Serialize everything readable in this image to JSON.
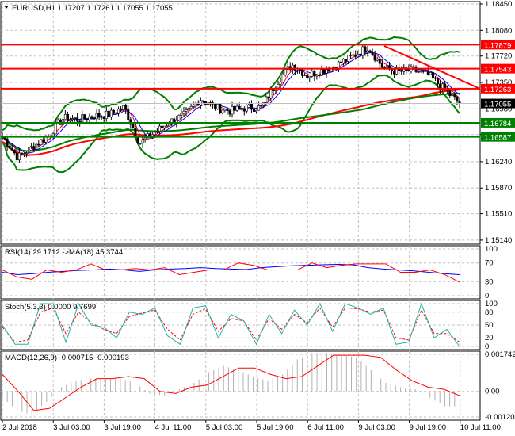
{
  "chart_data": [
    {
      "type": "candlestick",
      "title": "EURUSD,H1",
      "ohlc_header": [
        "1.17207",
        "1.17261",
        "1.17055",
        "1.17055"
      ],
      "y_ticks": [
        "1.18450",
        "1.18080",
        "1.17720",
        "1.17350",
        "1.16980",
        "1.16620",
        "1.16240",
        "1.15870",
        "1.15510",
        "1.15140"
      ],
      "ylim": [
        1.1514,
        1.1845
      ],
      "close_path": [
        1.166,
        1.163,
        1.1645,
        1.166,
        1.1685,
        1.1683,
        1.1688,
        1.169,
        1.17,
        1.165,
        1.1665,
        1.168,
        1.169,
        1.1712,
        1.17,
        1.1695,
        1.17,
        1.17,
        1.1735,
        1.176,
        1.1745,
        1.1752,
        1.176,
        1.1772,
        1.1785,
        1.1755,
        1.175,
        1.1752,
        1.1745,
        1.1725,
        1.17055
      ],
      "levels": [
        {
          "value": "1.17879",
          "color": "#ff0000"
        },
        {
          "value": "1.17543",
          "color": "#ff0000"
        },
        {
          "value": "1.17263",
          "color": "#ff0000"
        },
        {
          "value": "1.16784",
          "color": "#008000"
        },
        {
          "value": "1.16587",
          "color": "#008000"
        }
      ],
      "current_price": "1.17055",
      "bollinger_color": "#008000",
      "ma_colors": [
        "#ff0000",
        "#0000ff",
        "#008000"
      ]
    },
    {
      "type": "line",
      "label": "RSI(14) 29.1712  ->MA(18) 45.3744",
      "y_ticks": [
        "100",
        "70",
        "30",
        "0"
      ],
      "ylim": [
        0,
        100
      ],
      "rsi": [
        55,
        40,
        35,
        55,
        50,
        55,
        68,
        55,
        55,
        58,
        55,
        60,
        45,
        50,
        55,
        55,
        70,
        65,
        55,
        55,
        55,
        70,
        60,
        65,
        68,
        68,
        68,
        50,
        50,
        55,
        45,
        29
      ],
      "ma": [
        50,
        45,
        47,
        50,
        52,
        54,
        55,
        57,
        55,
        52,
        55,
        57,
        58,
        60,
        58,
        57,
        56,
        60,
        62,
        64,
        65,
        66,
        67,
        66,
        60,
        57,
        55,
        53,
        50,
        47,
        45
      ]
    },
    {
      "type": "line",
      "label": "Stoch(5,3,3) 0.0000 9.7699",
      "y_ticks": [
        "100",
        "80",
        "50",
        "20",
        "0"
      ],
      "ylim": [
        0,
        100
      ],
      "main": [
        50,
        5,
        5,
        100,
        100,
        10,
        100,
        50,
        45,
        20,
        80,
        75,
        90,
        25,
        5,
        90,
        95,
        20,
        75,
        60,
        5,
        75,
        30,
        85,
        50,
        100,
        35,
        100,
        90,
        75,
        90,
        5,
        10,
        100,
        20,
        40,
        0
      ],
      "signal": [
        45,
        10,
        15,
        80,
        90,
        30,
        80,
        55,
        40,
        30,
        70,
        78,
        85,
        40,
        15,
        75,
        88,
        35,
        65,
        60,
        15,
        65,
        40,
        75,
        55,
        90,
        45,
        90,
        88,
        80,
        85,
        20,
        15,
        85,
        30,
        30,
        10
      ]
    },
    {
      "type": "bar+line",
      "label": "MACD(12,26,9) -0.000715 -0.000193",
      "y_ticks": [
        "0.001742",
        "0.00",
        "-0.001204"
      ],
      "ylim": [
        -0.001204,
        0.001742
      ],
      "histogram": [
        -0.0003,
        -0.0009,
        -0.0011,
        -0.0005,
        0.0002,
        0.0005,
        0.0006,
        0.0006,
        0.0006,
        0.0004,
        -0.0001,
        -0.0002,
        0.0001,
        0.0004,
        0.0009,
        0.0012,
        0.001,
        0.0007,
        0.0005,
        0.0008,
        0.0015,
        0.0018,
        0.0018,
        0.0017,
        0.0016,
        0.001,
        0.0004,
        0.0002,
        0.0001,
        -0.0003,
        -0.0007
      ],
      "signal_line": [
        0.0008,
        0.0,
        -0.0009,
        -0.0008,
        -0.0003,
        0.0002,
        0.0006,
        0.0006,
        0.0007,
        0.0006,
        0.0,
        -0.0001,
        0.0002,
        0.0003,
        0.0007,
        0.0011,
        0.0011,
        0.0008,
        0.0006,
        0.0007,
        0.0012,
        0.0017,
        0.0017,
        0.0017,
        0.0016,
        0.001,
        0.0005,
        0.0002,
        0.0001,
        -0.0002
      ]
    }
  ],
  "x_ticks": [
    "2 Jul 2018",
    "3 Jul 03:00",
    "3 Jul 19:00",
    "4 Jul 11:00",
    "5 Jul 03:00",
    "5 Jul 19:00",
    "6 Jul 11:00",
    "9 Jul 03:00",
    "9 Jul 19:00",
    "10 Jul 11:00"
  ]
}
